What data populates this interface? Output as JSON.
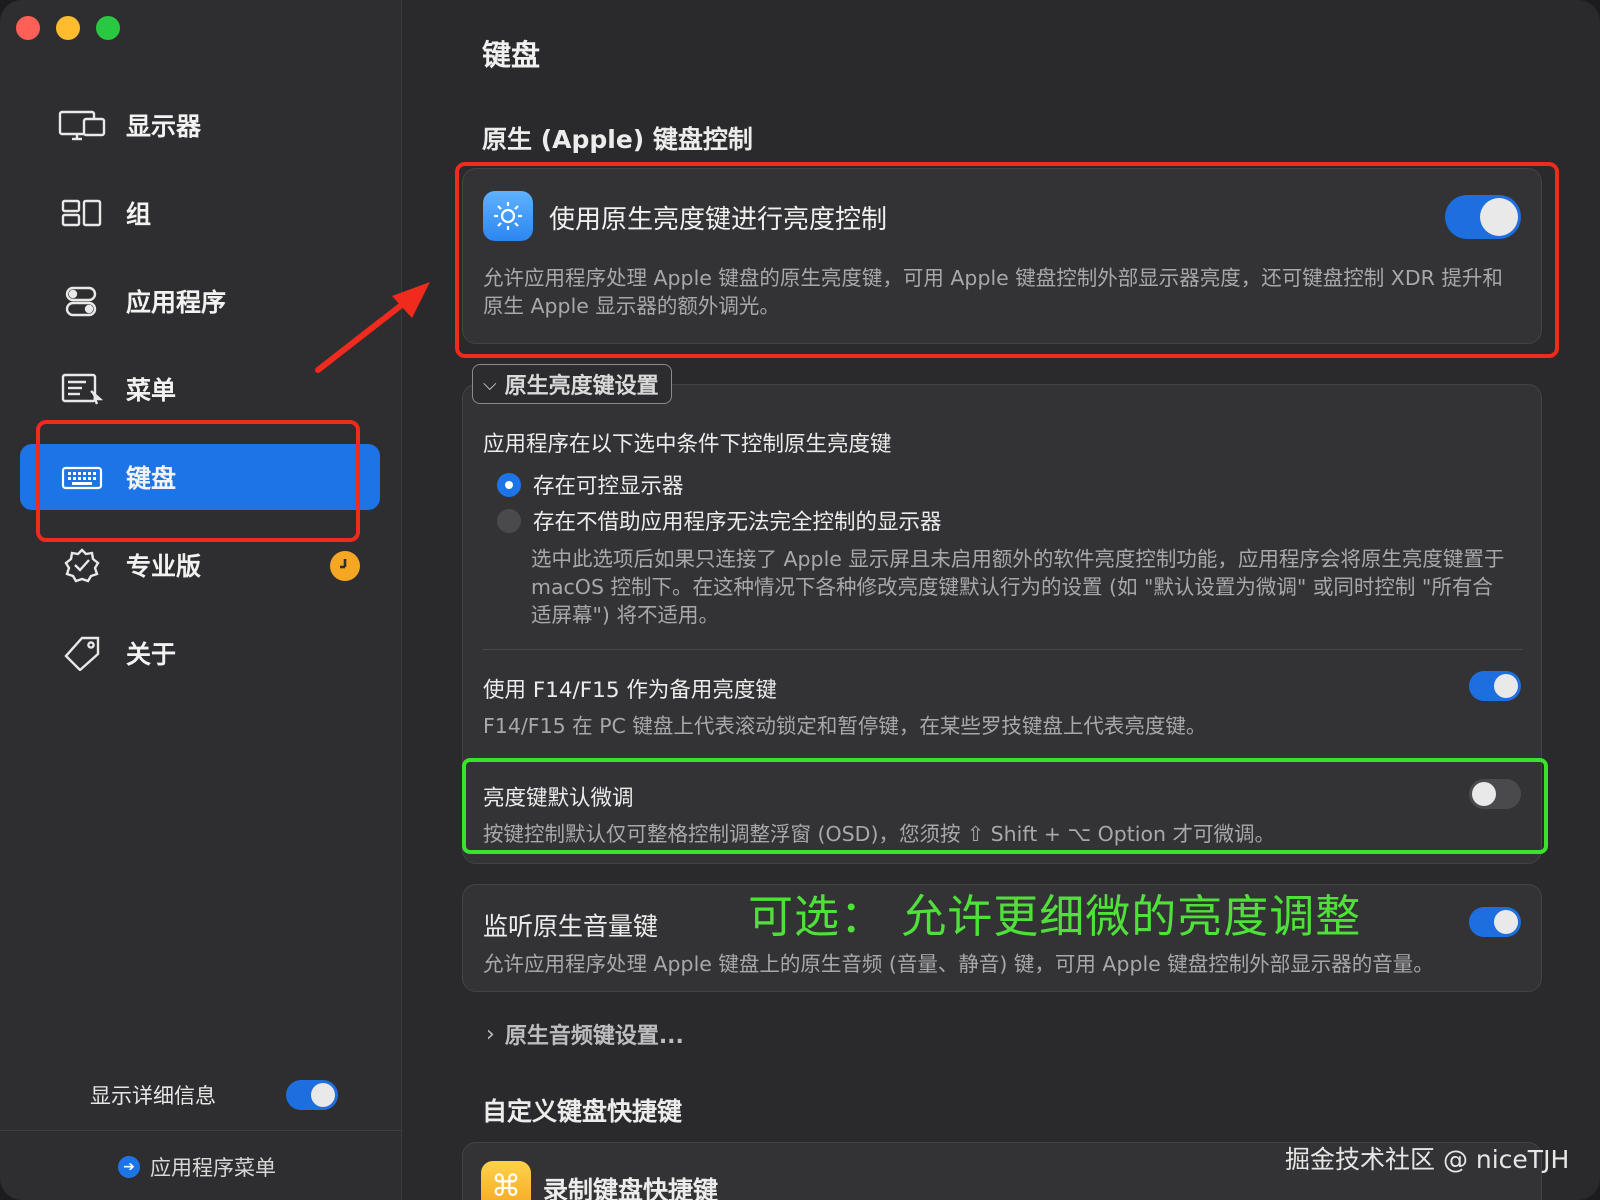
{
  "sidebar": {
    "items": [
      {
        "label": "显示器",
        "icon": "display-icon"
      },
      {
        "label": "组",
        "icon": "groups-icon"
      },
      {
        "label": "应用程序",
        "icon": "apps-toggle-icon"
      },
      {
        "label": "菜单",
        "icon": "menu-icon"
      },
      {
        "label": "键盘",
        "icon": "keyboard-icon",
        "active": true
      },
      {
        "label": "专业版",
        "icon": "pro-badge-icon"
      },
      {
        "label": "关于",
        "icon": "tag-icon"
      }
    ],
    "show_details_label": "显示详细信息",
    "show_details_on": true,
    "app_menu_label": "应用程序菜单"
  },
  "main": {
    "page_title": "键盘",
    "native_section_title": "原生 (Apple) 键盘控制",
    "native_toggle": {
      "title": "使用原生亮度键进行亮度控制",
      "on": true,
      "desc": "允许应用程序处理 Apple 键盘的原生亮度键，可用 Apple 键盘控制外部显示器亮度，还可键盘控制 XDR 提升和原生 Apple 显示器的额外调光。"
    },
    "brightness_settings": {
      "disclosure_label": "原生亮度键设置",
      "question": "应用程序在以下选中条件下控制原生亮度键",
      "options": [
        {
          "label": "存在可控显示器",
          "selected": true
        },
        {
          "label": "存在不借助应用程序无法完全控制的显示器",
          "selected": false
        }
      ],
      "option_desc": "选中此选项后如果只连接了 Apple 显示屏且未启用额外的软件亮度控制功能，应用程序会将原生亮度键置于 macOS 控制下。在这种情况下各种修改亮度键默认行为的设置 (如 \"默认设置为微调\" 或同时控制 \"所有合适屏幕\") 将不适用。",
      "f14": {
        "title": "使用 F14/F15 作为备用亮度键",
        "desc": "F14/F15 在 PC 键盘上代表滚动锁定和暂停键，在某些罗技键盘上代表亮度键。",
        "on": true
      },
      "fine": {
        "title": "亮度键默认微调",
        "desc": "按键控制默认仅可整格控制调整浮窗 (OSD)，您须按 ⇧ Shift + ⌥ Option 才可微调。",
        "on": false
      }
    },
    "volume": {
      "title": "监听原生音量键",
      "desc": "允许应用程序处理 Apple 键盘上的原生音频 (音量、静音) 键，可用 Apple 键盘控制外部显示器的音量。",
      "on": true
    },
    "audio_link": "原生音频键设置...",
    "custom_section_title": "自定义键盘快捷键",
    "record_title": "录制键盘快捷键"
  },
  "annotations": {
    "green_note": "可选： 允许更细微的亮度调整",
    "watermark": "掘金技术社区 @ niceTJH"
  },
  "colors": {
    "accent": "#1d74e6",
    "annotation_red": "#f02a1c",
    "annotation_green": "#39e22b"
  }
}
